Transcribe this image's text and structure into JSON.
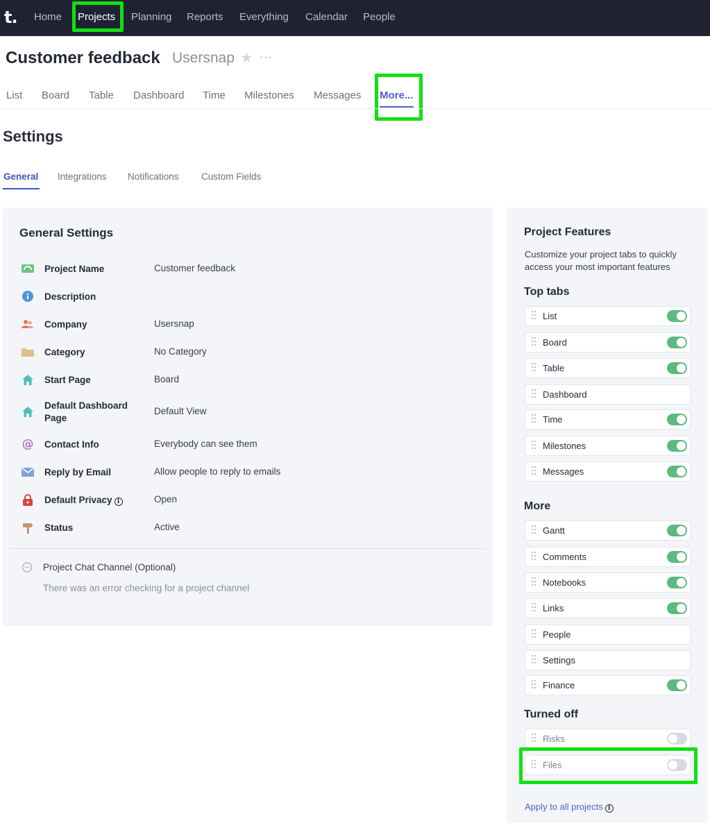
{
  "topnav": {
    "logo": "t.",
    "items": [
      "Home",
      "Projects",
      "Planning",
      "Reports",
      "Everything",
      "Calendar",
      "People"
    ],
    "active": "Projects"
  },
  "header": {
    "title": "Customer feedback",
    "subtitle": "Usersnap",
    "more_dots": "···"
  },
  "project_tabs": [
    "List",
    "Board",
    "Table",
    "Dashboard",
    "Time",
    "Milestones",
    "Messages",
    "More..."
  ],
  "settings": {
    "title": "Settings",
    "tabs": [
      "General",
      "Integrations",
      "Notifications",
      "Custom Fields"
    ],
    "active_tab": "General"
  },
  "general": {
    "title": "General Settings",
    "rows": [
      {
        "label": "Project Name",
        "value": "Customer feedback",
        "icon": "project-icon"
      },
      {
        "label": "Description",
        "value": "",
        "icon": "info-icon"
      },
      {
        "label": "Company",
        "value": "Usersnap",
        "icon": "company-icon"
      },
      {
        "label": "Category",
        "value": "No Category",
        "icon": "folder-icon"
      },
      {
        "label": "Start Page",
        "value": "Board",
        "icon": "home-icon"
      },
      {
        "label": "Default Dashboard Page",
        "value": "Default View",
        "icon": "home-icon"
      },
      {
        "label": "Contact Info",
        "value": "Everybody can see them",
        "icon": "at-icon"
      },
      {
        "label": "Reply by Email",
        "value": "Allow people to reply to emails",
        "icon": "envelope-icon"
      },
      {
        "label": "Default Privacy",
        "value": "Open",
        "icon": "lock-icon"
      },
      {
        "label": "Status",
        "value": "Active",
        "icon": "signpost-icon"
      }
    ],
    "chat_label": "Project Chat Channel (Optional)",
    "chat_note": "There was an error checking for a project channel"
  },
  "features": {
    "title": "Project Features",
    "description": "Customize your project tabs to quickly access your most important features",
    "sections": [
      {
        "title": "Top tabs",
        "items": [
          {
            "name": "List",
            "toggle": "on"
          },
          {
            "name": "Board",
            "toggle": "on"
          },
          {
            "name": "Table",
            "toggle": "on"
          },
          {
            "name": "Dashboard",
            "toggle": "none"
          },
          {
            "name": "Time",
            "toggle": "on"
          },
          {
            "name": "Milestones",
            "toggle": "on"
          },
          {
            "name": "Messages",
            "toggle": "on"
          }
        ]
      },
      {
        "title": "More",
        "items": [
          {
            "name": "Gantt",
            "toggle": "on"
          },
          {
            "name": "Comments",
            "toggle": "on"
          },
          {
            "name": "Notebooks",
            "toggle": "on"
          },
          {
            "name": "Links",
            "toggle": "on"
          },
          {
            "name": "People",
            "toggle": "none"
          },
          {
            "name": "Settings",
            "toggle": "none"
          },
          {
            "name": "Finance",
            "toggle": "on"
          }
        ]
      },
      {
        "title": "Turned off",
        "items": [
          {
            "name": "Risks",
            "toggle": "off"
          },
          {
            "name": "Files",
            "toggle": "off"
          }
        ]
      }
    ],
    "apply_link": "Apply to all projects"
  },
  "colors": {
    "nav_bg": "#1e2233",
    "accent": "#4f5fd5",
    "toggle_on": "#5cba80",
    "highlight": "#11e011"
  }
}
